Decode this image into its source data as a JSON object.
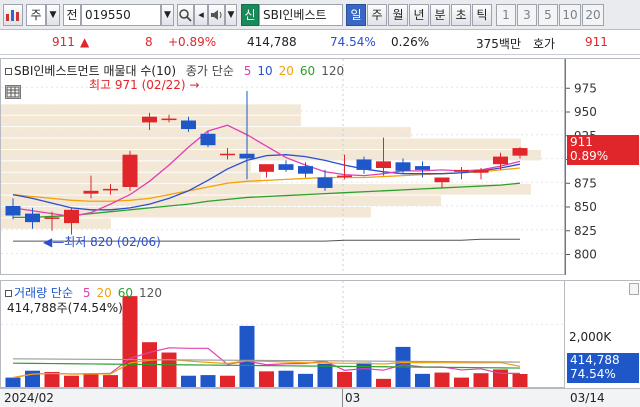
{
  "toolbar": {
    "market_label": "주",
    "period_label": "전",
    "code": "019550",
    "name": "SBI인베스트",
    "credit_badge": "신",
    "periods": [
      "일",
      "주",
      "월",
      "년",
      "분",
      "초",
      "틱"
    ],
    "active_period": "일",
    "intervals": [
      "1",
      "3",
      "5",
      "10",
      "20"
    ]
  },
  "pricebar": {
    "price": "911",
    "arrow": "▲",
    "change": "8",
    "change_pct": "+0.89%",
    "volume": "414,788",
    "volume_ratio": "74.54%",
    "turnover": "0.26%",
    "trade_value": "375백만",
    "quote_label": "호가",
    "quote_price": "911"
  },
  "price_chart": {
    "title": "SBI인베스트먼트 매물대 수(10)",
    "legend_prefix": "종가 단순",
    "ma_legend": [
      "5",
      "10",
      "20",
      "60",
      "120"
    ],
    "high_annotation": "최고 971 (02/22)",
    "low_annotation": "최저 820 (02/06)",
    "current_price_tag": "911",
    "current_pct_tag": "0.89%",
    "colors": {
      "up": "#e0262b",
      "down": "#1f57c8",
      "ma5": "#e040b0",
      "ma10": "#2a4fd0",
      "ma20": "#f2a20c",
      "ma60": "#2ca02c",
      "ma120": "#555555",
      "profile": "#f3e7d5"
    }
  },
  "volume_chart": {
    "legend_prefix": "거래량 단순",
    "ma_legend": [
      "5",
      "20",
      "60",
      "120"
    ],
    "current_label": "414,788주(74.54%)",
    "axis_tick": "2,000K",
    "current_tag": "414,788",
    "current_pct_tag": "74.54%"
  },
  "dates": {
    "start": "2024/02",
    "mid": "03",
    "end": "03/14"
  },
  "chart_data": {
    "type": "candlestick",
    "price_axis": {
      "ticks": [
        975,
        950,
        925,
        900,
        875,
        850,
        825,
        800
      ],
      "ylim": [
        790,
        990
      ]
    },
    "candles": [
      {
        "o": 850,
        "h": 858,
        "l": 836,
        "c": 840
      },
      {
        "o": 842,
        "h": 848,
        "l": 826,
        "c": 833
      },
      {
        "o": 838,
        "h": 844,
        "l": 824,
        "c": 838
      },
      {
        "o": 832,
        "h": 848,
        "l": 820,
        "c": 846
      },
      {
        "o": 863,
        "h": 882,
        "l": 858,
        "c": 866
      },
      {
        "o": 868,
        "h": 873,
        "l": 862,
        "c": 868
      },
      {
        "o": 870,
        "h": 908,
        "l": 866,
        "c": 904
      },
      {
        "o": 938,
        "h": 948,
        "l": 930,
        "c": 944
      },
      {
        "o": 942,
        "h": 946,
        "l": 938,
        "c": 942
      },
      {
        "o": 940,
        "h": 944,
        "l": 928,
        "c": 931
      },
      {
        "o": 926,
        "h": 929,
        "l": 912,
        "c": 914
      },
      {
        "o": 905,
        "h": 911,
        "l": 899,
        "c": 905
      },
      {
        "o": 905,
        "h": 971,
        "l": 878,
        "c": 900
      },
      {
        "o": 886,
        "h": 894,
        "l": 880,
        "c": 894
      },
      {
        "o": 894,
        "h": 898,
        "l": 886,
        "c": 888
      },
      {
        "o": 892,
        "h": 896,
        "l": 880,
        "c": 884
      },
      {
        "o": 880,
        "h": 888,
        "l": 866,
        "c": 869
      },
      {
        "o": 882,
        "h": 904,
        "l": 878,
        "c": 882
      },
      {
        "o": 899,
        "h": 902,
        "l": 884,
        "c": 888
      },
      {
        "o": 890,
        "h": 922,
        "l": 882,
        "c": 897
      },
      {
        "o": 896,
        "h": 900,
        "l": 884,
        "c": 887
      },
      {
        "o": 892,
        "h": 897,
        "l": 880,
        "c": 888
      },
      {
        "o": 875,
        "h": 880,
        "l": 869,
        "c": 880
      },
      {
        "o": 886,
        "h": 891,
        "l": 878,
        "c": 888
      },
      {
        "o": 885,
        "h": 890,
        "l": 878,
        "c": 888
      },
      {
        "o": 894,
        "h": 906,
        "l": 888,
        "c": 902
      },
      {
        "o": 903,
        "h": 912,
        "l": 900,
        "c": 911
      }
    ],
    "ma5": [
      848,
      845,
      842,
      839,
      843,
      852,
      862,
      876,
      893,
      912,
      929,
      935,
      925,
      913,
      901,
      893,
      886,
      883,
      882,
      884,
      887,
      887,
      888,
      887,
      888,
      892,
      897
    ],
    "ma10": [
      862,
      858,
      853,
      848,
      846,
      846,
      848,
      852,
      858,
      866,
      877,
      889,
      898,
      903,
      904,
      902,
      898,
      893,
      889,
      886,
      884,
      884,
      884,
      885,
      887,
      890,
      894
    ],
    "ma20": [
      862,
      860,
      858,
      856,
      855,
      855,
      856,
      858,
      862,
      866,
      870,
      874,
      876,
      877,
      878,
      879,
      880,
      880,
      880,
      881,
      882,
      883,
      884,
      885,
      886,
      888,
      890
    ],
    "ma60": [
      838,
      838,
      839,
      840,
      842,
      844,
      846,
      848,
      850,
      852,
      855,
      857,
      859,
      860,
      861,
      862,
      863,
      864,
      865,
      866,
      867,
      868,
      869,
      870,
      871,
      872,
      874
    ],
    "ma120": [
      813,
      813,
      813,
      813,
      813,
      813,
      813,
      813,
      813,
      813,
      813,
      813,
      813,
      813,
      813,
      813,
      813,
      814,
      814,
      814,
      814,
      814,
      814,
      814,
      815,
      815,
      815
    ],
    "volume_k": [
      300,
      520,
      480,
      360,
      440,
      380,
      2900,
      1430,
      1100,
      360,
      380,
      360,
      1950,
      500,
      520,
      420,
      740,
      480,
      780,
      260,
      1280,
      420,
      460,
      300,
      440,
      560,
      415
    ],
    "volume_ylim": [
      0,
      3000
    ]
  }
}
